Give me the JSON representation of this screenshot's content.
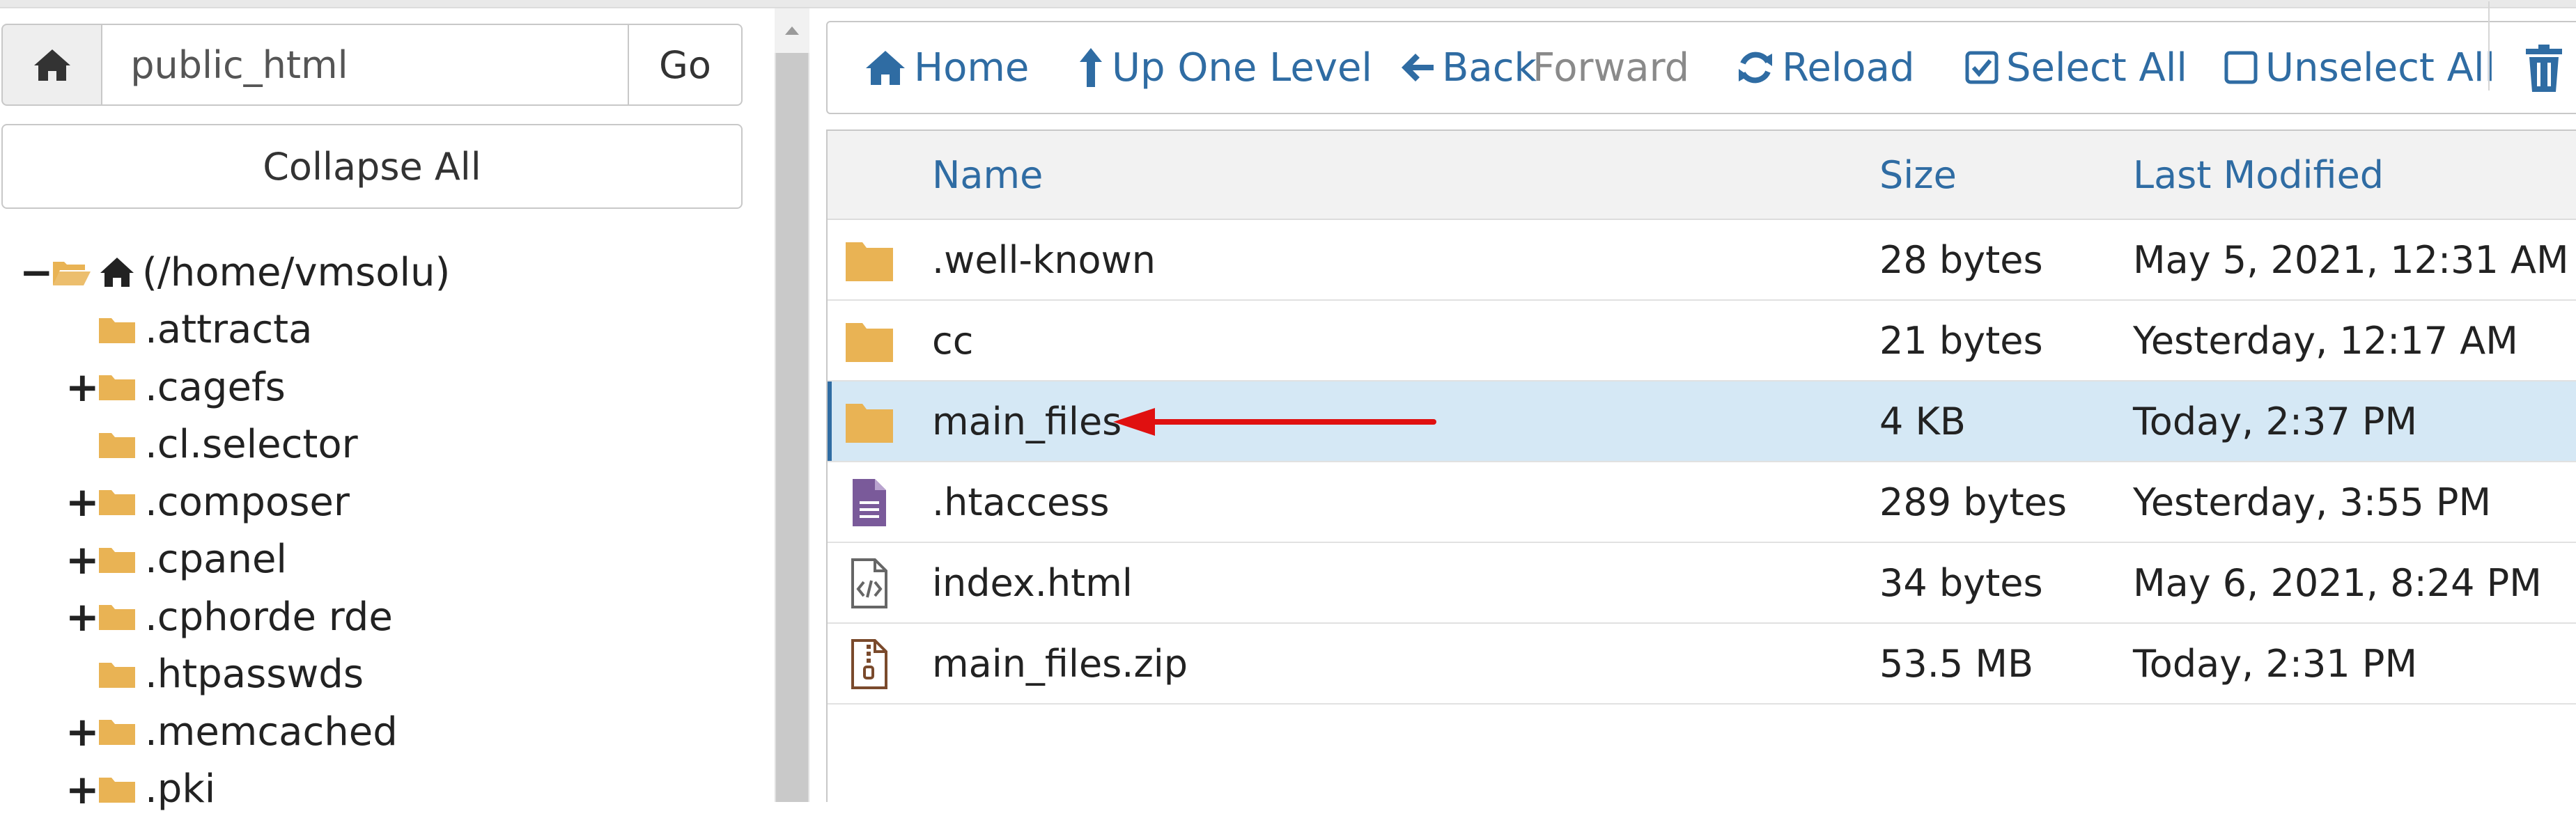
{
  "sidebar": {
    "path_value": "public_html",
    "go_label": "Go",
    "collapse_label": "Collapse All",
    "tree": [
      {
        "label": "(/home/vmsolu)",
        "toggle": "−",
        "level": 0,
        "is_root": true,
        "expanded": true
      },
      {
        "label": ".attracta",
        "toggle": "",
        "level": 1
      },
      {
        "label": ".cagefs",
        "toggle": "+",
        "level": 1
      },
      {
        "label": ".cl.selector",
        "toggle": "",
        "level": 1
      },
      {
        "label": ".composer",
        "toggle": "+",
        "level": 1
      },
      {
        "label": ".cpanel",
        "toggle": "+",
        "level": 1
      },
      {
        "label": ".cphorde        rde",
        "toggle": "+",
        "level": 1
      },
      {
        "label": ".htpasswds",
        "toggle": "",
        "level": 1
      },
      {
        "label": ".memcached",
        "toggle": "+",
        "level": 1
      },
      {
        "label": ".pki",
        "toggle": "+",
        "level": 1
      }
    ]
  },
  "toolbar": {
    "home": "Home",
    "up_one_level": "Up One Level",
    "back": "Back",
    "forward": "Forward",
    "reload": "Reload",
    "select_all": "Select All",
    "unselect_all": "Unselect All"
  },
  "table": {
    "headers": {
      "name": "Name",
      "size": "Size",
      "modified": "Last Modified"
    },
    "rows": [
      {
        "icon": "folder-icon",
        "name": ".well-known",
        "size": "28 bytes",
        "modified": "May 5, 2021, 12:31 AM",
        "selected": false
      },
      {
        "icon": "folder-icon",
        "name": "cc",
        "size": "21 bytes",
        "modified": "Yesterday, 12:17 AM",
        "selected": false
      },
      {
        "icon": "folder-icon",
        "name": "main_files",
        "size": "4 KB",
        "modified": "Today, 2:37 PM",
        "selected": true
      },
      {
        "icon": "text-file-icon",
        "name": ".htaccess",
        "size": "289 bytes",
        "modified": "Yesterday, 3:55 PM",
        "selected": false
      },
      {
        "icon": "code-file-icon",
        "name": "index.html",
        "size": "34 bytes",
        "modified": "May 6, 2021, 8:24 PM",
        "selected": false
      },
      {
        "icon": "zip-file-icon",
        "name": "main_files.zip",
        "size": "53.5 MB",
        "modified": "Today, 2:31 PM",
        "selected": false
      }
    ]
  },
  "annotation": {
    "arrow_color": "#e01010",
    "points_to": "main_files"
  },
  "colors": {
    "link": "#2f6ca3",
    "folder": "#e9b354",
    "selected_row": "#d5e8f5",
    "text_file": "#7a5a9a"
  }
}
